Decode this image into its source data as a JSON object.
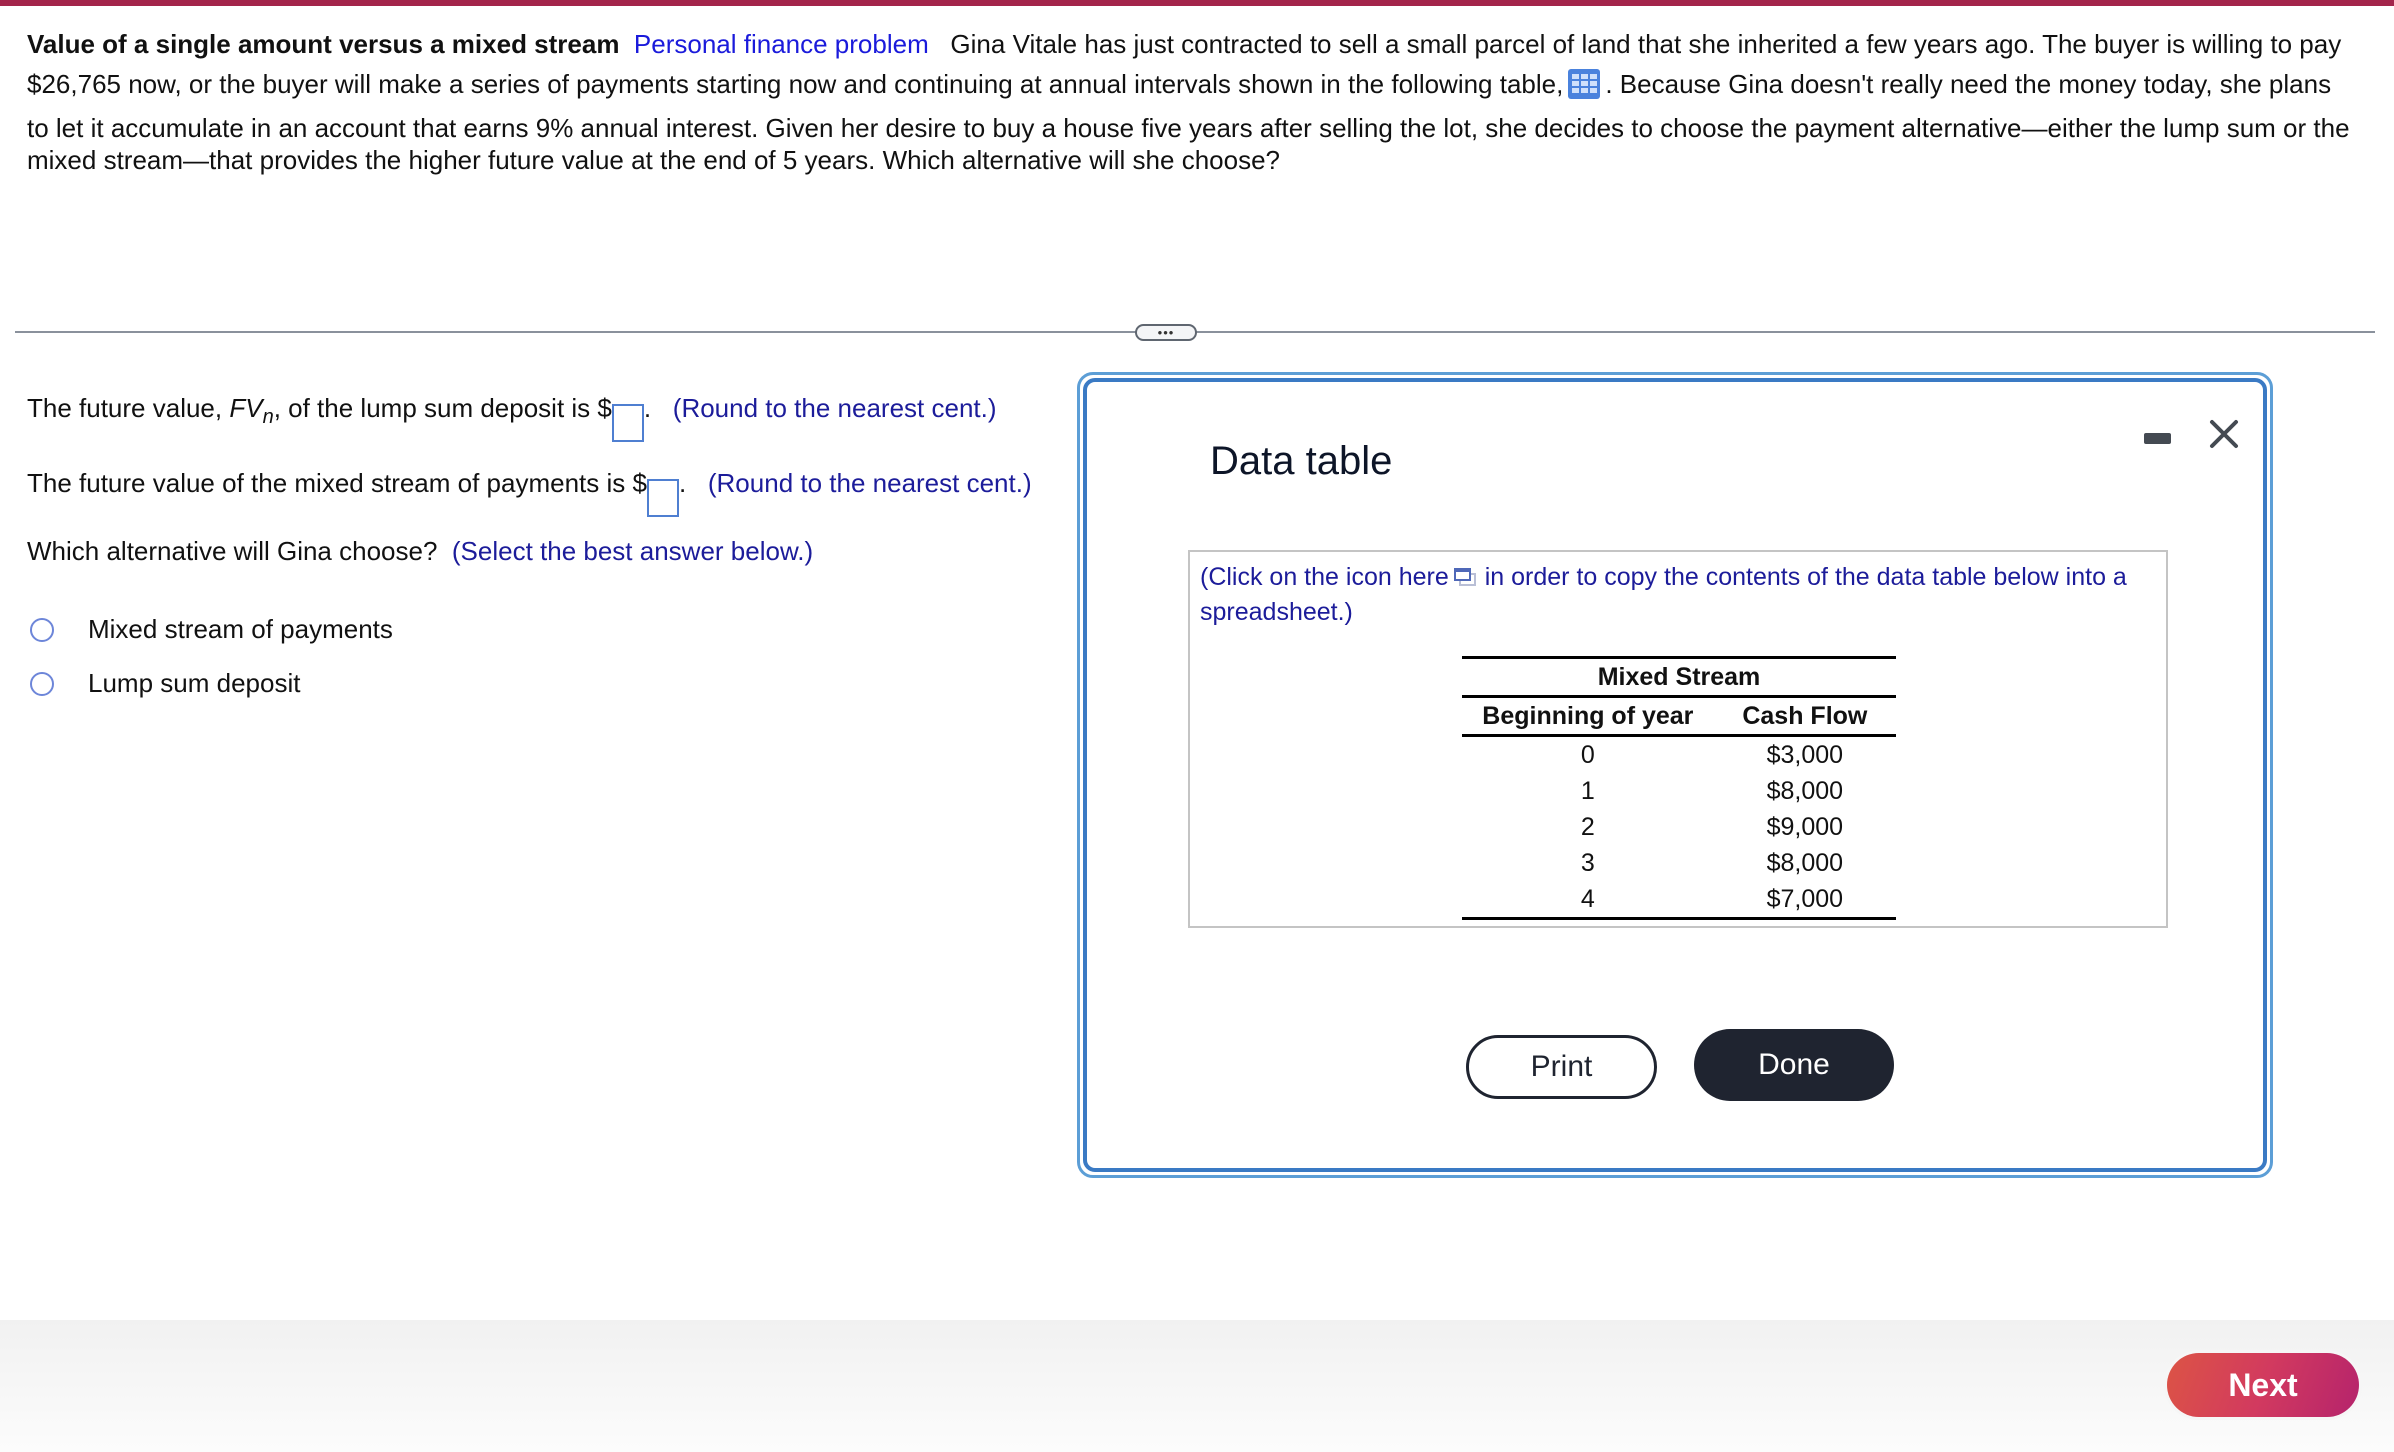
{
  "colors": {
    "top_bar": "#a3254b",
    "hint_text": "#1c1c9a",
    "tag_text": "#1a1adb",
    "dialog_border": "#3a7ac4",
    "done_button": "#1f2430",
    "next_gradient_start": "#dc5445",
    "next_gradient_end": "#b5236c"
  },
  "problem": {
    "title": "Value of a single amount versus a mixed stream",
    "tag": "Personal finance problem",
    "line1": "Gina Vitale has just contracted to sell a small parcel of land that she inherited a few years ago.  The buyer is willing to pay",
    "line2_before_icon": "$26,765 now, or the buyer will make  a series of payments starting now and continuing at annual intervals shown in the following table,",
    "line2_after_icon": ".  Because Gina doesn't really need the money today, she plans",
    "line3": "to let it accumulate in an account that earns 9% annual interest.  Given her desire to buy a house five years after selling the lot, she decides to choose the payment alternative—either the lump sum or the",
    "line4": "mixed stream—that provides the higher future value at the end of 5 years.  Which alternative will she choose?",
    "table_icon": "table-grid-icon"
  },
  "divider": {
    "more_label": "•••"
  },
  "questions": {
    "q1_prefix": "The future value, ",
    "q1_fv": "FV",
    "q1_sub": "n",
    "q1_mid": ", of the lump sum deposit is $",
    "q1_after": ".",
    "q1_hint": "(Round to the nearest cent.)",
    "q1_value": "",
    "q2_prefix": "The future value of the mixed stream of payments is $",
    "q2_after": ".",
    "q2_hint": "(Round to the nearest cent.)",
    "q2_value": "",
    "q3_text": "Which alternative will Gina choose?",
    "q3_hint": "(Select the best answer below.)",
    "options": [
      {
        "label": "Mixed stream of payments",
        "selected": false
      },
      {
        "label": "Lump sum deposit",
        "selected": false
      }
    ]
  },
  "dialog": {
    "title": "Data table",
    "minimize_icon": "minimize-icon",
    "close_icon": "close-icon",
    "copy_note_before": "(Click on the icon here",
    "copy_note_after": "in order to copy the contents of the data table below into a spreadsheet.)",
    "copy_icon": "copy-icon",
    "table": {
      "caption": "Mixed Stream",
      "headers": [
        "Beginning of year",
        "Cash Flow"
      ],
      "rows": [
        [
          "0",
          "$3,000"
        ],
        [
          "1",
          "$8,000"
        ],
        [
          "2",
          "$9,000"
        ],
        [
          "3",
          "$8,000"
        ],
        [
          "4",
          "$7,000"
        ]
      ]
    },
    "print_label": "Print",
    "done_label": "Done"
  },
  "footer": {
    "next_label": "Next"
  }
}
